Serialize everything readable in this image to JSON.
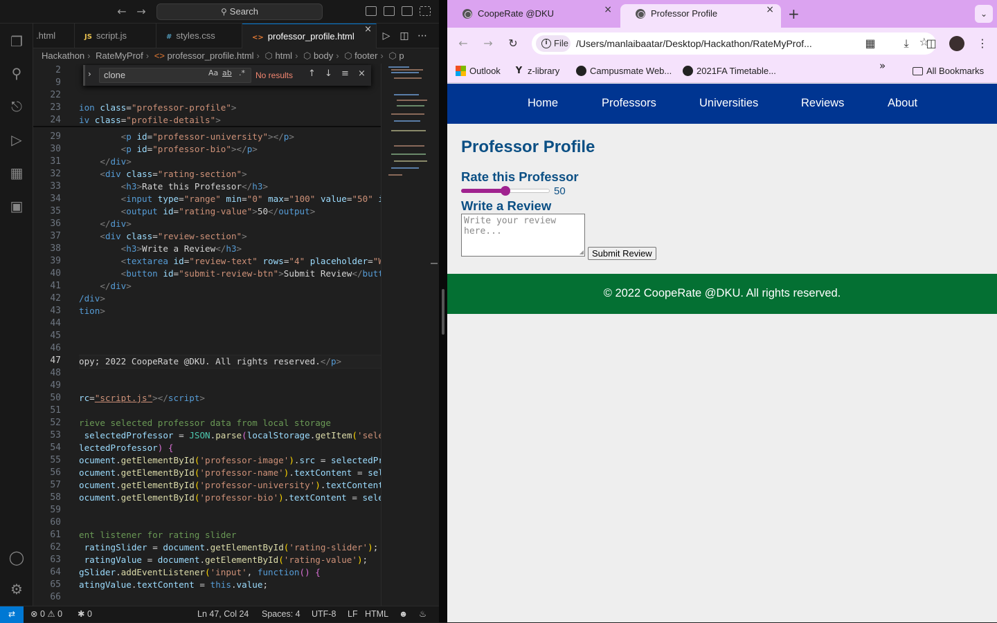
{
  "vscode": {
    "titlebar": {
      "search_label": "Search"
    },
    "tabs": [
      {
        "label": ".html",
        "icon": "html-icon"
      },
      {
        "label": "script.js",
        "icon_text": "JS"
      },
      {
        "label": "styles.css",
        "icon_text": "#"
      },
      {
        "label": "professor_profile.html",
        "icon_text": "<>",
        "active": true
      }
    ],
    "breadcrumb": [
      "Hackathon",
      "RateMyProf",
      "professor_profile.html",
      "html",
      "body",
      "footer",
      "p"
    ],
    "find": {
      "query": "clone",
      "result": "No results",
      "opt_case": "Aa",
      "opt_word": "ab",
      "opt_regex": ".*"
    },
    "line_numbers": [
      "2",
      "9",
      "22",
      "23",
      "24",
      "29",
      "30",
      "31",
      "32",
      "33",
      "34",
      "35",
      "36",
      "37",
      "38",
      "39",
      "40",
      "41",
      "42",
      "43",
      "44",
      "45",
      "46",
      "47",
      "48",
      "49",
      "50",
      "51",
      "52",
      "53",
      "54",
      "55",
      "56",
      "57",
      "58",
      "59",
      "60",
      "61",
      "62",
      "63",
      "64",
      "65",
      "66"
    ],
    "current_line": "47",
    "status": {
      "errors": "0",
      "warnings": "0",
      "ports": "0",
      "cursor": "Ln 47, Col 24",
      "spaces": "Spaces: 4",
      "encoding": "UTF-8",
      "eol": "LF",
      "language": "HTML"
    }
  },
  "chrome": {
    "tabs": [
      {
        "title": "CoopeRate @DKU"
      },
      {
        "title": "Professor Profile",
        "active": true
      }
    ],
    "omnibox": {
      "chip": "File",
      "url": "/Users/manlaibaatar/Desktop/Hackathon/RateMyProf..."
    },
    "bookmarks": [
      "Outlook",
      "z-library",
      "Campusmate Web...",
      "2021FA Timetable..."
    ],
    "all_bookmarks": "All Bookmarks",
    "colors": {
      "tab_strip": "#dba3f0",
      "toolbar": "#f5e2fc"
    }
  },
  "page": {
    "nav": [
      "Home",
      "Professors",
      "Universities",
      "Reviews",
      "About"
    ],
    "heading": "Professor Profile",
    "rate_heading": "Rate this Professor",
    "rating": {
      "min": 0,
      "max": 100,
      "value": 50,
      "display": "50"
    },
    "review_heading": "Write a Review",
    "review_placeholder": "Write your review here...",
    "submit_label": "Submit Review",
    "footer": "© 2022 CoopeRate @DKU. All rights reserved.",
    "colors": {
      "nav_bg": "#003591",
      "footer_bg": "#047033",
      "heading": "#0b4f84",
      "slider": "#a0238f"
    }
  }
}
